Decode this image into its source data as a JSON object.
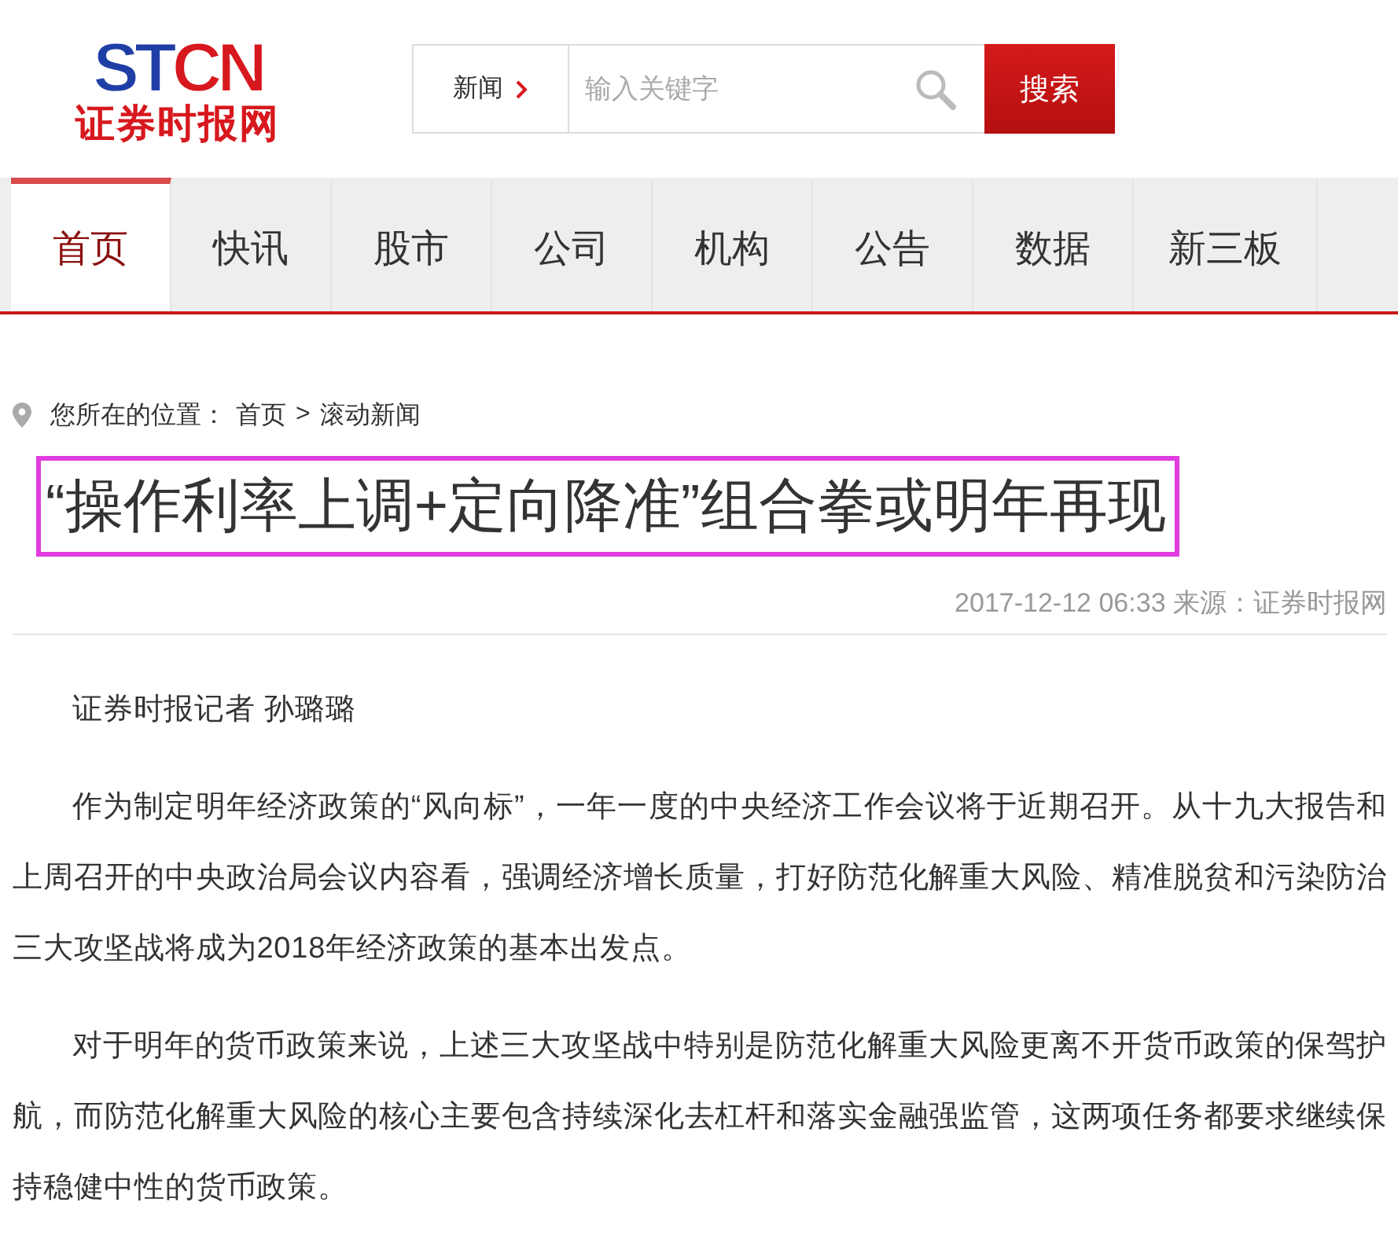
{
  "logo": {
    "mark": [
      {
        "text": "ST",
        "color": "#1f3fa6"
      },
      {
        "text": "CN",
        "color": "#d7181e"
      }
    ],
    "name": "证券时报网"
  },
  "search": {
    "category": "新闻",
    "placeholder": "输入关键字",
    "button": "搜索"
  },
  "nav": [
    {
      "label": "首页",
      "selected": true
    },
    {
      "label": "快讯",
      "selected": false
    },
    {
      "label": "股市",
      "selected": false
    },
    {
      "label": "公司",
      "selected": false
    },
    {
      "label": "机构",
      "selected": false
    },
    {
      "label": "公告",
      "selected": false
    },
    {
      "label": "数据",
      "selected": false
    },
    {
      "label": "新三板",
      "selected": false
    }
  ],
  "breadcrumb": {
    "label": "您所在的位置：",
    "items": [
      "首页",
      "滚动新闻"
    ],
    "separator": ">"
  },
  "article": {
    "title": "“操作利率上调+定向降准”组合拳或明年再现",
    "meta": "2017-12-12 06:33 来源：证券时报网",
    "paragraphs": [
      "证券时报记者 孙璐璐",
      "作为制定明年经济政策的“风向标”，一年一度的中央经济工作会议将于近期召开。从十九大报告和上周召开的中央政治局会议内容看，强调经济增长质量，打好防范化解重大风险、精准脱贫和污染防治三大攻坚战将成为2018年经济政策的基本出发点。",
      "对于明年的货币政策来说，上述三大攻坚战中特别是防范化解重大风险更离不开货币政策的保驾护航，而防范化解重大风险的核心主要包含持续深化去杠杆和落实金融强监管，这两项任务都要求继续保持稳健中性的货币政策。"
    ]
  }
}
